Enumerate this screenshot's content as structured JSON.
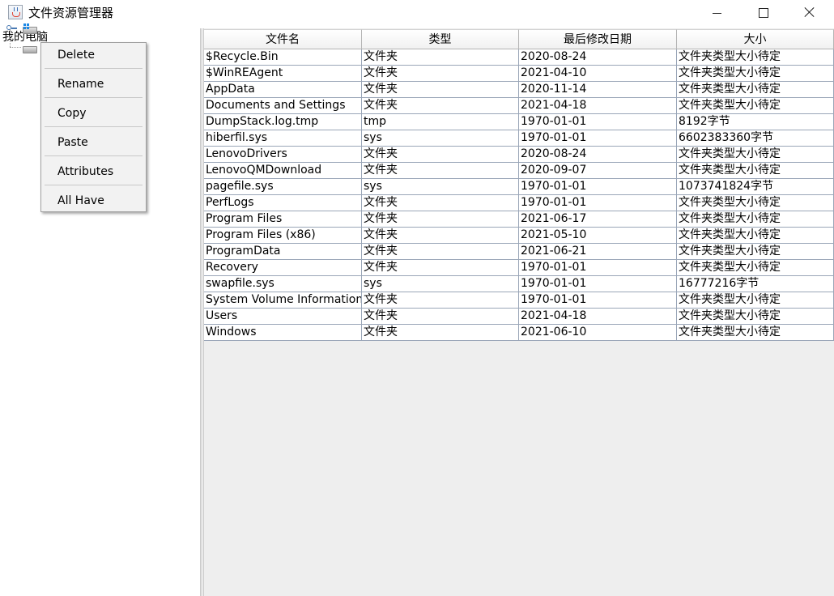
{
  "window": {
    "title": "文件资源管理器"
  },
  "tree": {
    "root_label": "我的电脑"
  },
  "table": {
    "columns": [
      "文件名",
      "类型",
      "最后修改日期",
      "大小"
    ],
    "rows": [
      [
        "$Recycle.Bin",
        "文件夹",
        "2020-08-24",
        "文件夹类型大小待定"
      ],
      [
        "$WinREAgent",
        "文件夹",
        "2021-04-10",
        "文件夹类型大小待定"
      ],
      [
        "AppData",
        "文件夹",
        "2020-11-14",
        "文件夹类型大小待定"
      ],
      [
        "Documents and Settings",
        "文件夹",
        "2021-04-18",
        "文件夹类型大小待定"
      ],
      [
        "DumpStack.log.tmp",
        "tmp",
        "1970-01-01",
        "8192字节"
      ],
      [
        "hiberfil.sys",
        "sys",
        "1970-01-01",
        "6602383360字节"
      ],
      [
        "LenovoDrivers",
        "文件夹",
        "2020-08-24",
        "文件夹类型大小待定"
      ],
      [
        "LenovoQMDownload",
        "文件夹",
        "2020-09-07",
        "文件夹类型大小待定"
      ],
      [
        "pagefile.sys",
        "sys",
        "1970-01-01",
        "1073741824字节"
      ],
      [
        "PerfLogs",
        "文件夹",
        "1970-01-01",
        "文件夹类型大小待定"
      ],
      [
        "Program Files",
        "文件夹",
        "2021-06-17",
        "文件夹类型大小待定"
      ],
      [
        "Program Files (x86)",
        "文件夹",
        "2021-05-10",
        "文件夹类型大小待定"
      ],
      [
        "ProgramData",
        "文件夹",
        "2021-06-21",
        "文件夹类型大小待定"
      ],
      [
        "Recovery",
        "文件夹",
        "1970-01-01",
        "文件夹类型大小待定"
      ],
      [
        "swapfile.sys",
        "sys",
        "1970-01-01",
        "16777216字节"
      ],
      [
        "System Volume Information",
        "文件夹",
        "1970-01-01",
        "文件夹类型大小待定"
      ],
      [
        "Users",
        "文件夹",
        "2021-04-18",
        "文件夹类型大小待定"
      ],
      [
        "Windows",
        "文件夹",
        "2021-06-10",
        "文件夹类型大小待定"
      ]
    ]
  },
  "context_menu": {
    "items": [
      "Delete",
      "Rename",
      "Copy",
      "Paste",
      "Attributes",
      "All Have"
    ]
  },
  "icons": {
    "app": "java-cup-icon",
    "minimize": "minimize-icon",
    "maximize": "maximize-icon",
    "close": "close-icon",
    "tree_toggle": "tree-expand-handle-icon",
    "drive_c": "windows-drive-icon",
    "drive_d": "drive-icon"
  },
  "colors": {
    "grid_line": "#9aa6b8",
    "table_background": "#eeeeee",
    "menu_background": "#f2f2f2"
  }
}
